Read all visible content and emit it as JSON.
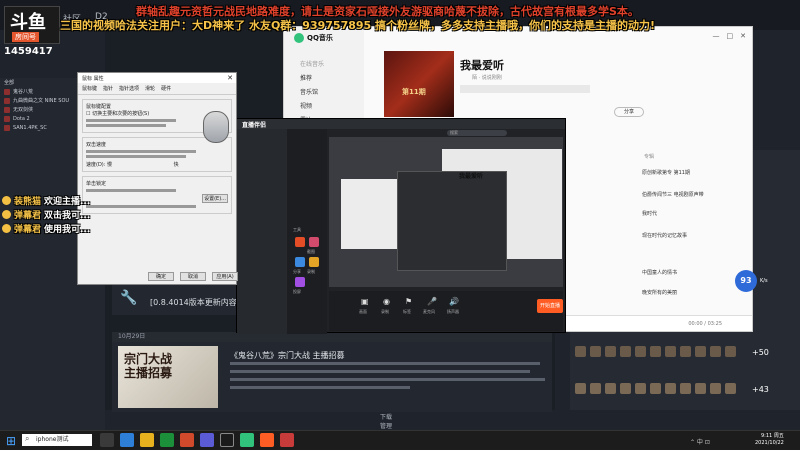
{
  "overlay": {
    "line1": "群轴乱趣元资哲元战民地路难度，请土是资家石哑接外友游驱商哈蔑不拔除，古代故宫有根最多学S本。",
    "line2": "三国的视频哈法关注用户：大D神来了  水友Q群：939757895  搞个粉丝牌，多多支持主播哦，你们的支持是主播的动力!"
  },
  "douyu": {
    "logo": "斗鱼",
    "room_label": "房间号",
    "room_id": "1459417"
  },
  "background_app": {
    "nav": [
      "库",
      "社区",
      "D2"
    ],
    "side_items": [
      "全部",
      "鬼谷八荒",
      "九曲微曲之文 NINE SOU",
      "无双剑侠",
      "Dota 2",
      "SAN1.4PK_SC"
    ],
    "news_title": "[0.8.4014版本更新内容]",
    "news_date": "10月29日",
    "news_thumb_text": "宗门大战\n主播招募",
    "news_head": "《鬼谷八荒》宗门大战 主播招募",
    "downloads_label": "下载",
    "downloads_sub": "管理",
    "plus50": "+50",
    "plus43": "+43",
    "net_speed": "93",
    "net_unit": "K/s"
  },
  "mouse_dialog": {
    "title": "鼠标 属性",
    "tabs": [
      "鼠标键",
      "指针",
      "指针选项",
      "滑轮",
      "硬件"
    ],
    "group1": "鼠标键配置",
    "check1": "切换主要和次要的按钮(S)",
    "group2": "双击速度",
    "speed_label": "速度(D):",
    "slow": "慢",
    "fast": "快",
    "group3": "单击锁定",
    "settings_btn": "设置(E)...",
    "ok": "确定",
    "cancel": "取消",
    "apply": "应用(A)"
  },
  "qq_music": {
    "app_name": "QQ音乐",
    "nav": [
      "在线音乐",
      "推荐",
      "音乐馆",
      "视频",
      "雷达"
    ],
    "playlist_title": "我最爱听",
    "author": "陌 · 说说刚刚",
    "share": "分享",
    "col_album": "专辑",
    "cover_text": "第11期",
    "rows": [
      "原创新歌第专 第11期",
      "伯爵传闻节三 电视剧原声带",
      "我时代",
      "现在时代的记忆故事",
      "中国童人的情书",
      "晚安所有的美丽"
    ],
    "time": "00:00 / 03:25",
    "win_ctrl": [
      "—",
      "□",
      "✕"
    ]
  },
  "broadcast": {
    "brand": "直播伴侣",
    "search": "搜索",
    "preview_title": "我最爱听",
    "left_labels": [
      "工具",
      "截图",
      "分享",
      "录制",
      "投屏"
    ],
    "bottom_labels": [
      "画面",
      "录制",
      "标签",
      "麦克风",
      "扬声器"
    ],
    "start": "开始直播"
  },
  "chat": [
    {
      "name": "装熊猫",
      "msg": "欢迎主播..."
    },
    {
      "name": "弹幕君",
      "msg": "双击我可..."
    },
    {
      "name": "弹幕君",
      "msg": "使用我可..."
    }
  ],
  "taskbar": {
    "search_placeholder": "iphone测试",
    "clock_time": "9:11 周五",
    "clock_date": "2021/10/22",
    "tray": "⌃ 中 ⊡"
  },
  "colors": {
    "accent": "#ff5d23",
    "qq_green": "#31c27c",
    "overlay_yellow": "#f6c348",
    "overlay_red": "#e0412b"
  }
}
